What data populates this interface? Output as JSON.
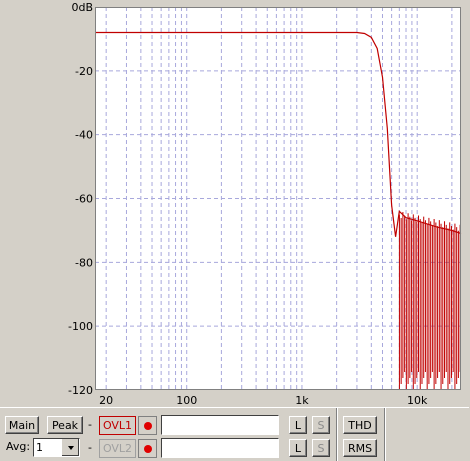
{
  "plot": {
    "background": "#ffffff",
    "frame_color": "#d4d0c8",
    "grid_color": "#a8a8dc",
    "trace_color": "#c00000",
    "y_ticks": [
      "0dB",
      "-20",
      "-40",
      "-60",
      "-80",
      "-100",
      "-120"
    ],
    "x_ticks": [
      "20",
      "100",
      "1k",
      "10k"
    ]
  },
  "chart_data": {
    "type": "line",
    "title": "",
    "xlabel": "",
    "ylabel": "",
    "x_scale": "log",
    "xlim": [
      16,
      24000
    ],
    "ylim": [
      -120,
      0
    ],
    "grid": true,
    "series": [
      {
        "x": [
          16,
          100,
          1000,
          3000,
          3500,
          4000,
          4500,
          5000,
          5500,
          6000,
          6500,
          7000,
          8000,
          10000,
          15000,
          20000,
          24000
        ],
        "y": [
          -8,
          -8,
          -8,
          -8,
          -8.3,
          -9.5,
          -13,
          -22,
          -38,
          -62,
          -72,
          -64,
          -66,
          -67,
          -69,
          -70,
          -71
        ]
      }
    ]
  },
  "controls": {
    "main_label": "Main",
    "peak_label": "Peak",
    "dash1": "-",
    "dash2": "-",
    "ovl1_label": "OVL1",
    "ovl2_label": "OVL2",
    "l1_label": "L",
    "s1_label": "S",
    "l2_label": "L",
    "s2_label": "S",
    "thd_label": "THD",
    "rms_label": "RMS",
    "avg_label": "Avg:",
    "avg_value": "1"
  }
}
